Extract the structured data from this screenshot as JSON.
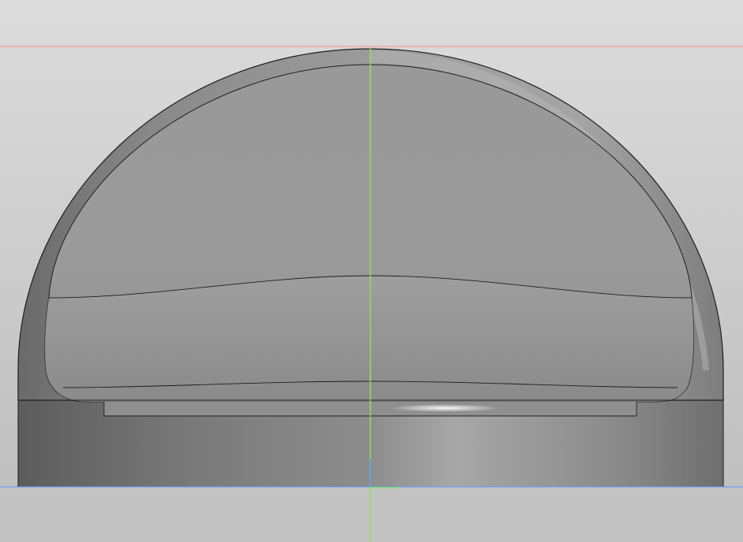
{
  "viewport": {
    "background_top": "#dcdcdc",
    "background_bottom": "#b9b9b9",
    "ground_color": "#c2c2c2"
  },
  "model": {
    "description_icon": "cad-3d-model",
    "body_colors": {
      "dark": "#5f5f5f",
      "mid": "#8e8e8e",
      "light": "#b3b3b3",
      "edge": "#1e1e1e"
    }
  },
  "axes": {
    "x_axis_color": "#ff8a8a",
    "y_axis_color": "#8be35a",
    "ground_plane_color": "#5a9cff",
    "origin_marker_color": "#5a9cff"
  }
}
